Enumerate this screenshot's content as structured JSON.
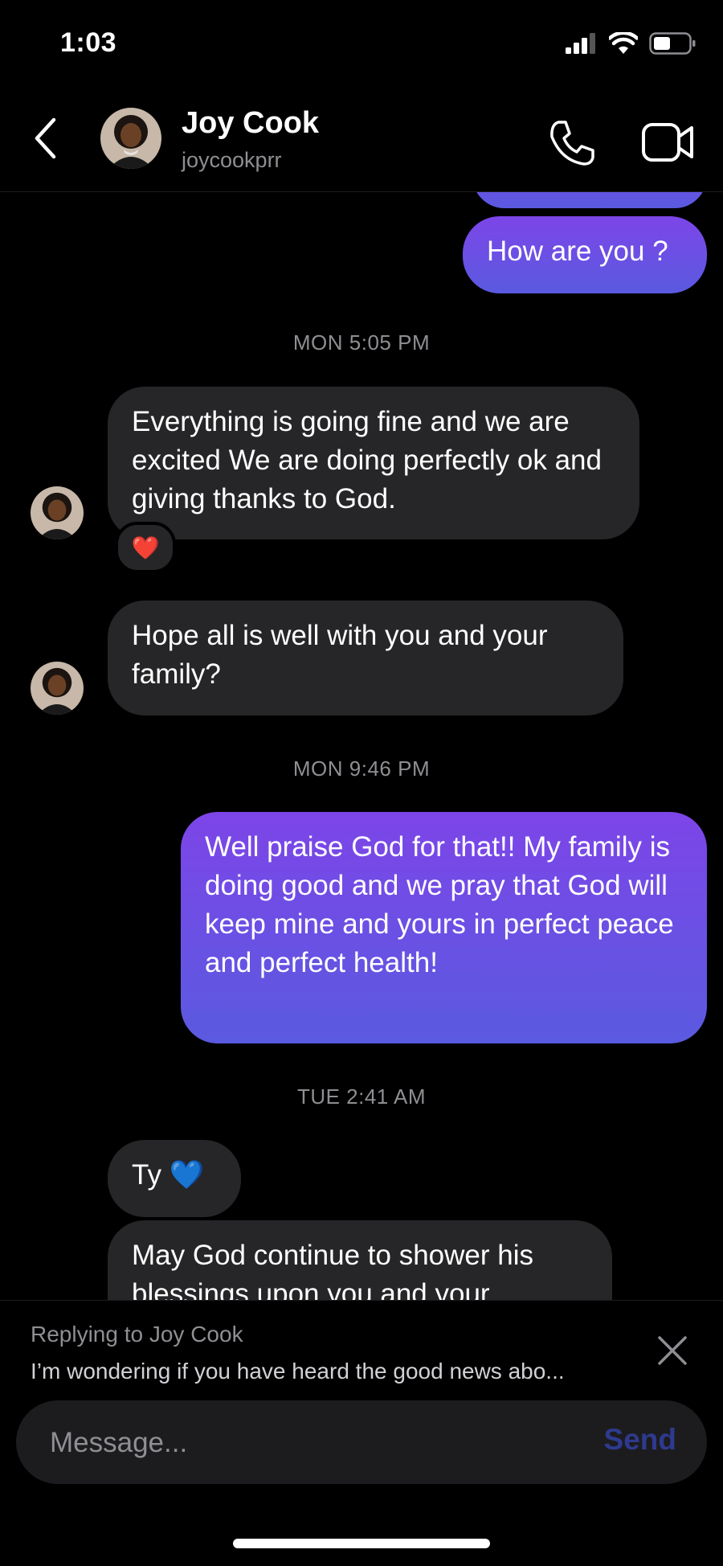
{
  "status_bar": {
    "time": "1:03"
  },
  "header": {
    "contact_name": "Joy Cook",
    "contact_handle": "joycookprr"
  },
  "messages": [
    {
      "text": "How are you ?"
    },
    {
      "timestamp": "MON 5:05 PM"
    },
    {
      "text": "Everything is going fine and we are excited We are doing perfectly ok and giving thanks to God.",
      "reaction": "❤️"
    },
    {
      "text": "Hope all is well with you and your family?"
    },
    {
      "timestamp": "MON 9:46 PM"
    },
    {
      "text": "Well praise God for that!! My family is doing good and we pray that God will keep mine and yours in perfect peace and perfect health!"
    },
    {
      "timestamp": "TUE 2:41 AM"
    },
    {
      "text": "Ty 💙"
    },
    {
      "text": "May God continue to shower his blessings upon you and your"
    }
  ],
  "reply": {
    "label": "Replying to Joy Cook",
    "preview": "I’m wondering if you have heard the good news abo..."
  },
  "composer": {
    "placeholder": "Message...",
    "send_label": "Send"
  },
  "colors": {
    "outgoing_top": "#7d45e8",
    "outgoing_bottom": "#5a5ae0",
    "incoming": "#262628",
    "send_disabled": "#2e3a8f"
  }
}
